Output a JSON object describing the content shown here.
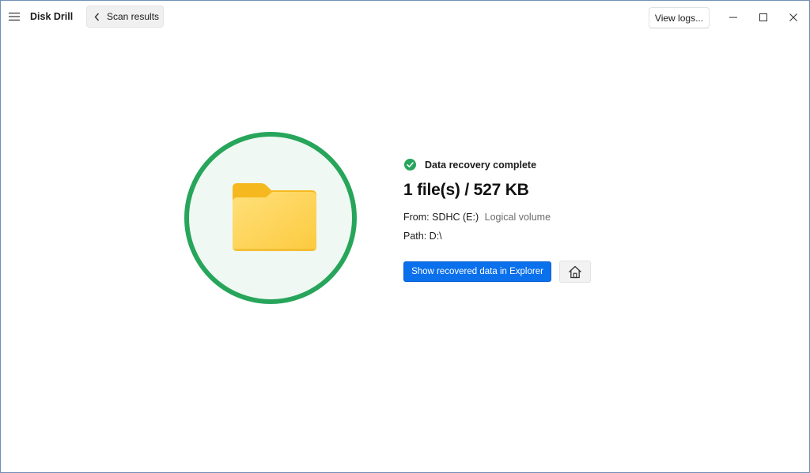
{
  "app": {
    "title": "Disk Drill"
  },
  "toolbar": {
    "back_label": "Scan results",
    "view_logs_label": "View logs..."
  },
  "status": {
    "message": "Data recovery complete",
    "color": "#27a55b"
  },
  "result": {
    "summary": "1 file(s) / 527 KB",
    "from_label": "From:",
    "from_value": "SDHC (E:)",
    "from_sub": "Logical volume",
    "path_label": "Path:",
    "path_value": "D:\\"
  },
  "actions": {
    "explorer_label": "Show recovered data in Explorer",
    "accent_color": "#0a70ec"
  },
  "icons": {
    "menu": "hamburger-icon",
    "back": "chevron-left-icon",
    "minimize": "minimize-icon",
    "maximize": "maximize-icon",
    "close": "close-icon",
    "status": "check-circle-icon",
    "folder": "folder-icon",
    "home": "home-icon"
  }
}
